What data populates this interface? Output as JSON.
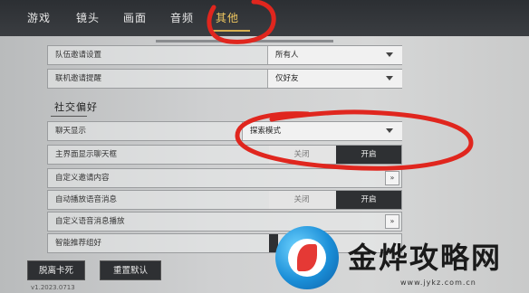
{
  "tabs": [
    {
      "label": "游戏"
    },
    {
      "label": "镜头"
    },
    {
      "label": "画面"
    },
    {
      "label": "音频"
    },
    {
      "label": "其他",
      "active": true
    }
  ],
  "settings": {
    "team_invite": {
      "label": "队伍邀请设置",
      "value": "所有人"
    },
    "contact_remind": {
      "label": "联机邀请提醒",
      "value": "仅好友"
    },
    "section_social": "社交偏好",
    "chat_display": {
      "label": "聊天显示",
      "value": "探索模式"
    },
    "main_chat_box": {
      "label": "主界面显示聊天框",
      "off": "关闭",
      "on": "开启",
      "state": "on"
    },
    "custom_invite": {
      "label": "自定义邀请内容",
      "more": "»"
    },
    "auto_voice": {
      "label": "自动播放语音消息",
      "off": "关闭",
      "on": "开启",
      "state": "on"
    },
    "custom_voice": {
      "label": "自定义语音消息播放",
      "more": "»"
    },
    "smart_recommend": {
      "label": "智能推荐组好"
    }
  },
  "buttons": {
    "leave": "脱离卡死",
    "reset": "重置默认"
  },
  "version_text": "v1.2023.0713",
  "watermark": {
    "brand": "金烨攻略网",
    "url": "www.jykz.com.cn"
  },
  "colors": {
    "topbar": "#2c2f33",
    "active_tab": "#f0c860",
    "toggle_on": "#2e3033",
    "annotation_red": "#e0261e"
  }
}
